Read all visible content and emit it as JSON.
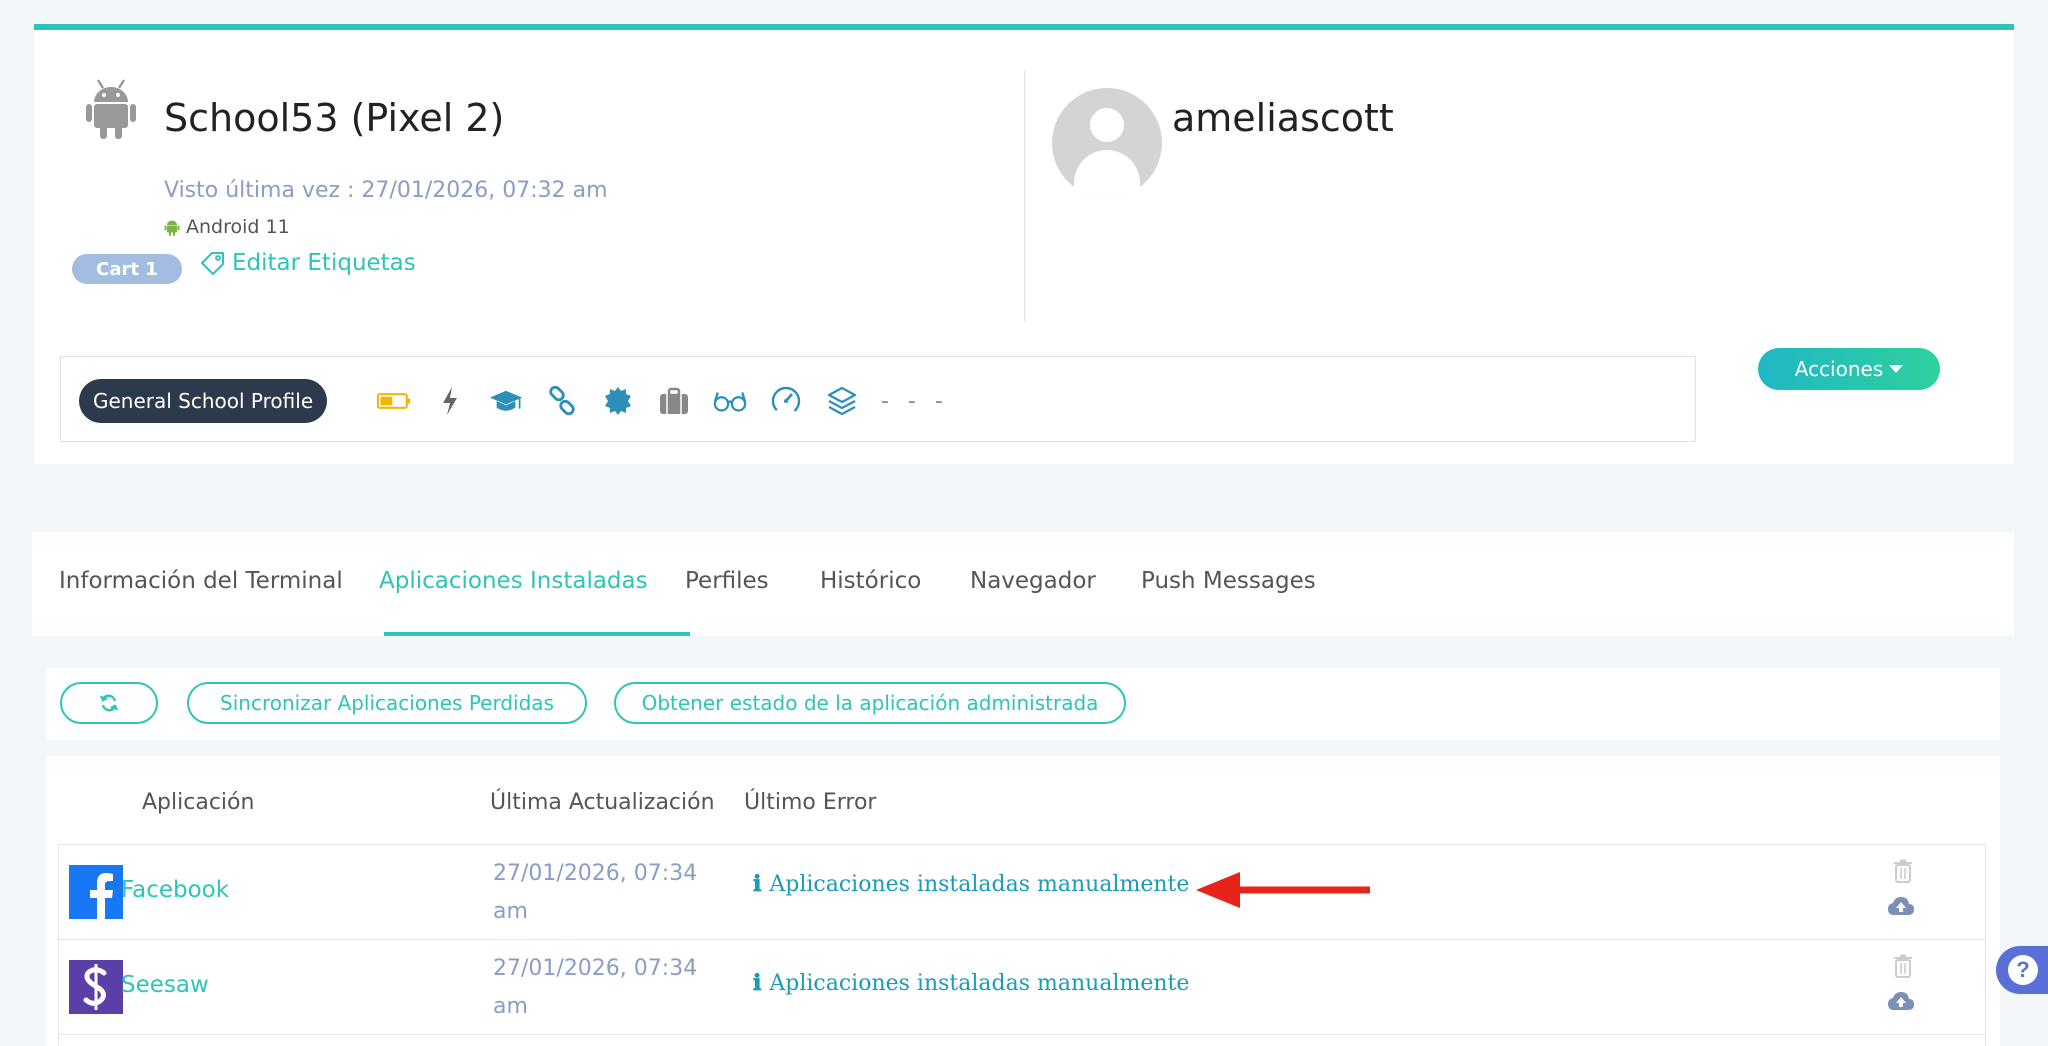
{
  "device": {
    "title": "School53 (Pixel 2)",
    "last_seen": "Visto última vez : 27/01/2026, 07:32 am",
    "os": "Android 11",
    "tag": "Cart 1",
    "edit_tags_label": "Editar Etiquetas",
    "user": "ameliascott",
    "profile": "General School Profile",
    "status_dashes": "- - -",
    "actions_label": "Acciones"
  },
  "tabs": [
    {
      "label": "Información del Terminal"
    },
    {
      "label": "Aplicaciones Instaladas"
    },
    {
      "label": "Perfiles"
    },
    {
      "label": "Histórico"
    },
    {
      "label": "Navegador"
    },
    {
      "label": "Push Messages"
    }
  ],
  "toolbar": {
    "sync_label": "Sincronizar Aplicaciones Perdidas",
    "status_label": "Obtener estado de la aplicación administrada"
  },
  "table": {
    "headers": [
      "Aplicación",
      "Última Actualización",
      "Último Error"
    ],
    "rows": [
      {
        "name": "Facebook",
        "date": "27/01/2026, 07:34 am",
        "error": "Aplicaciones instaladas manualmente"
      },
      {
        "name": "Seesaw",
        "date": "27/01/2026, 07:34 am",
        "error": "Aplicaciones instaladas manualmente"
      }
    ]
  },
  "colors": {
    "accent": "#2ec4b6",
    "profile_pill": "#2d3a4b",
    "battery": "#f2b705",
    "arrow": "#e8231a",
    "facebook": "#1877f2",
    "seesaw": "#5b3fa8"
  }
}
